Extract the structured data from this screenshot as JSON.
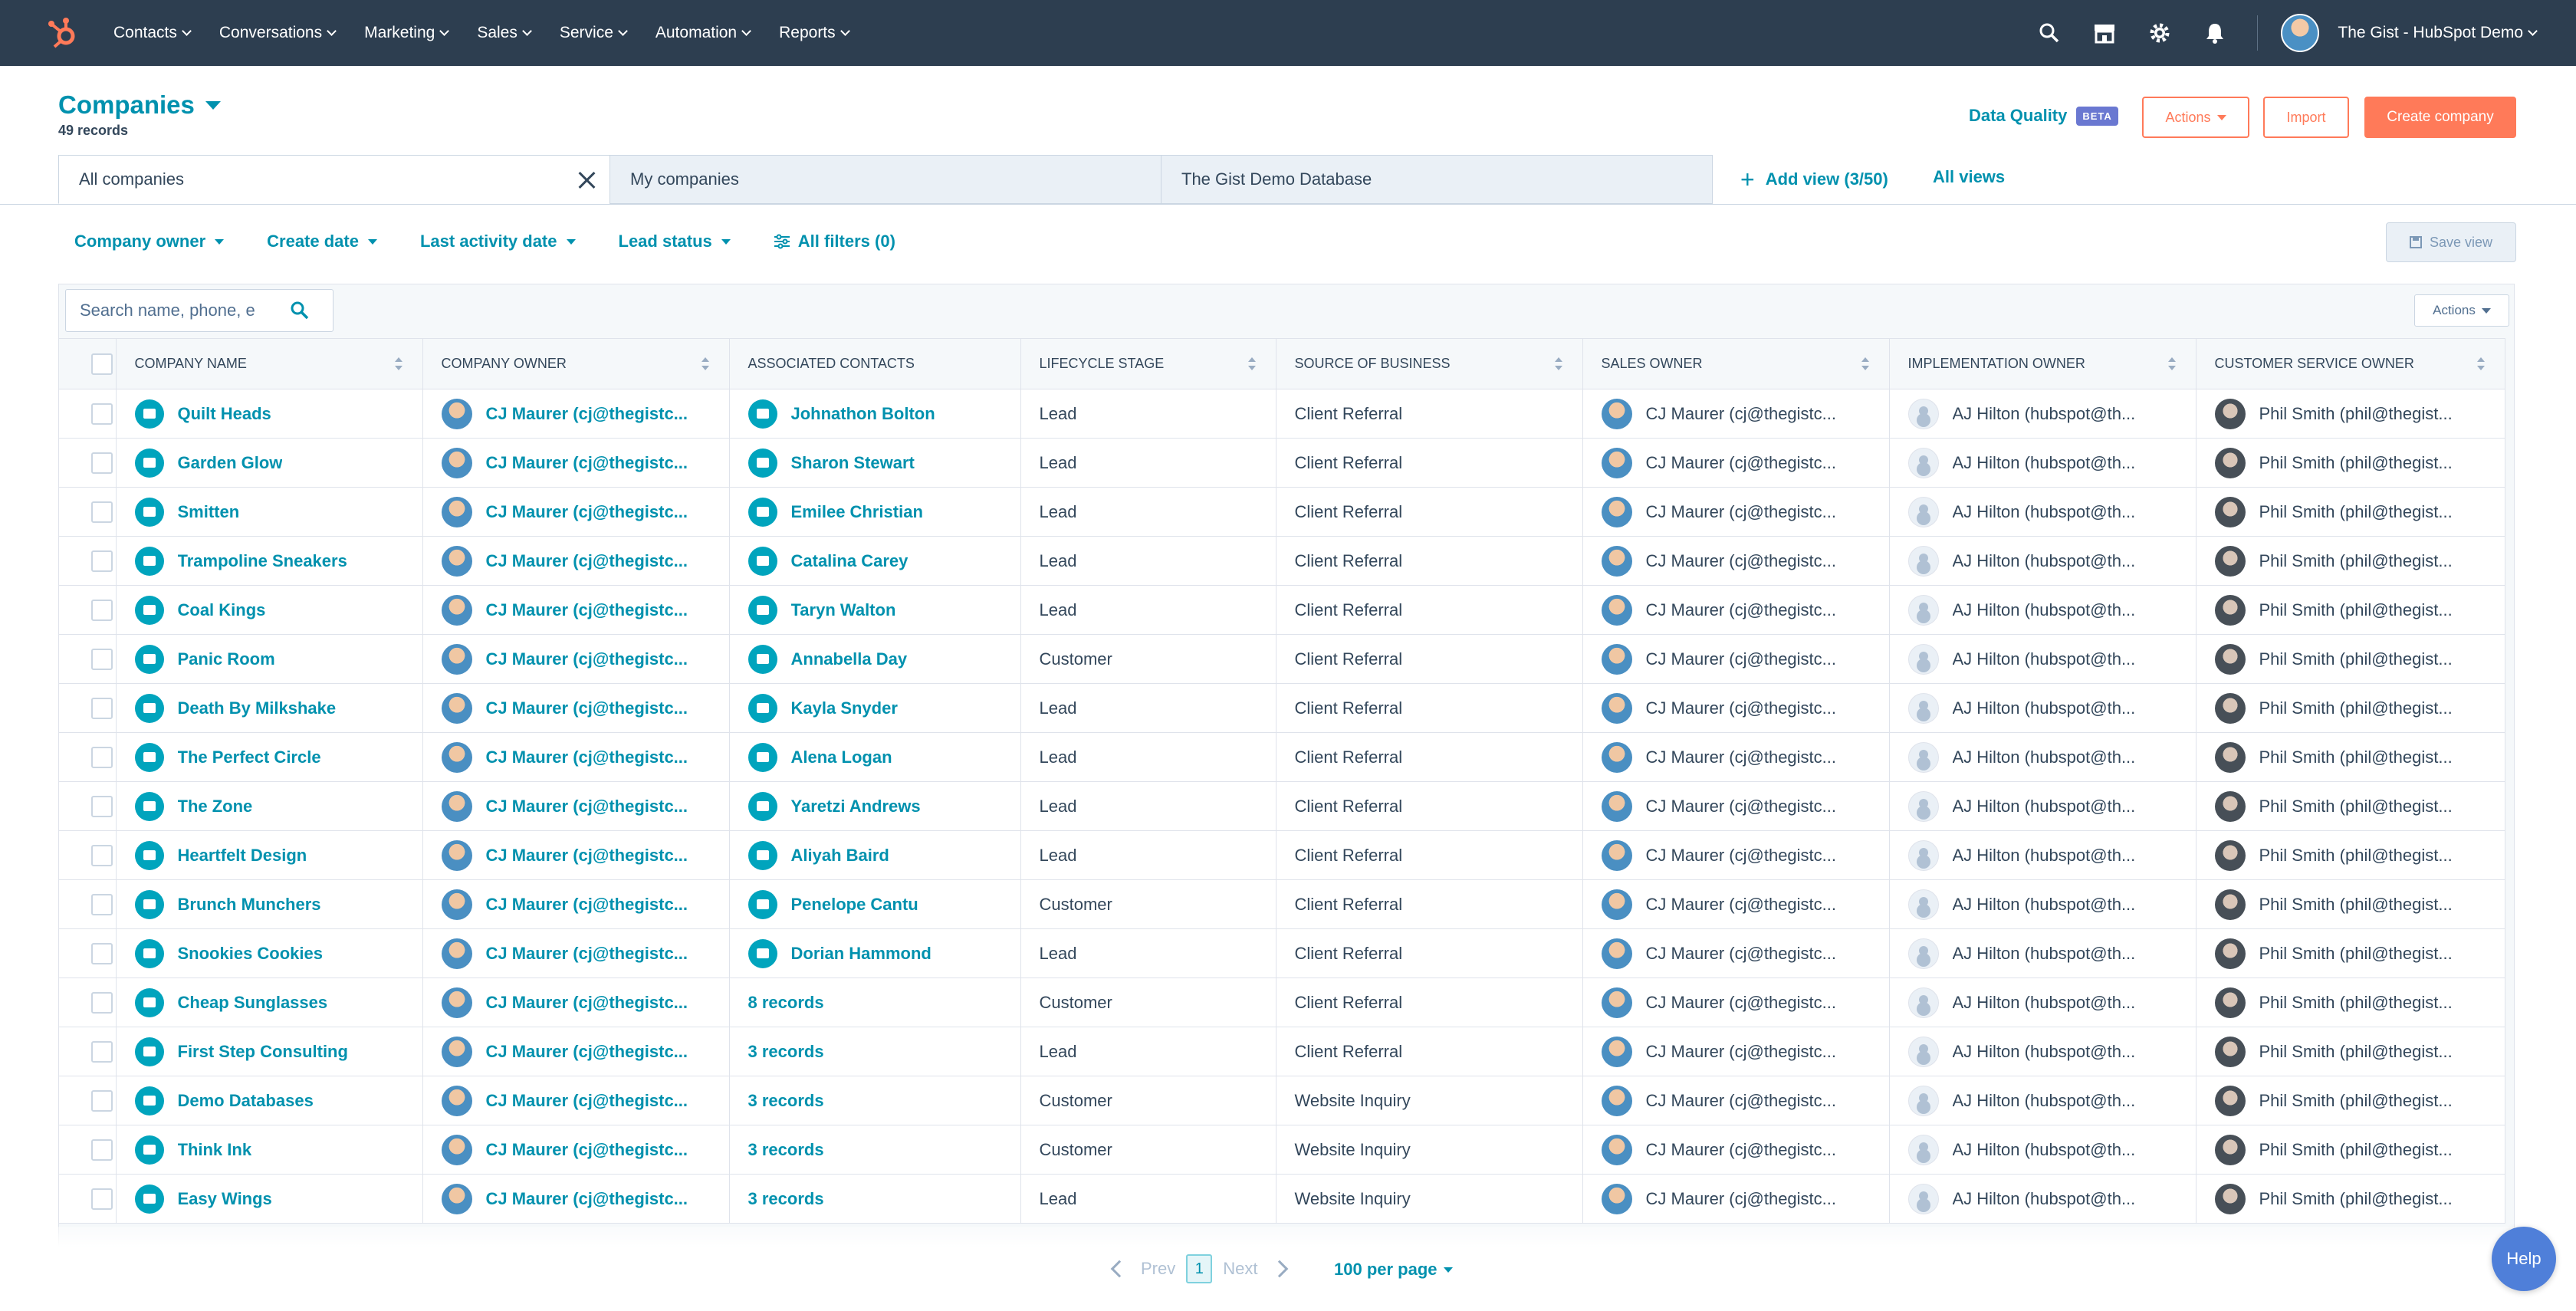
{
  "nav": {
    "items": [
      "Contacts",
      "Conversations",
      "Marketing",
      "Sales",
      "Service",
      "Automation",
      "Reports"
    ],
    "account": "The Gist - HubSpot Demo"
  },
  "header": {
    "title": "Companies",
    "record_count": "49 records",
    "data_quality": "Data Quality",
    "beta": "BETA",
    "actions": "Actions",
    "import": "Import",
    "create": "Create company"
  },
  "tabs": {
    "items": [
      "All companies",
      "My companies",
      "The Gist Demo Database"
    ],
    "add_view": "Add view (3/50)",
    "all_views": "All views"
  },
  "filters": {
    "items": [
      "Company owner",
      "Create date",
      "Last activity date",
      "Lead status"
    ],
    "all_filters": "All filters (0)",
    "save_view": "Save view"
  },
  "table": {
    "search_placeholder": "Search name, phone, e",
    "actions": "Actions",
    "columns": [
      "COMPANY NAME",
      "COMPANY OWNER",
      "ASSOCIATED CONTACTS",
      "LIFECYCLE STAGE",
      "SOURCE OF BUSINESS",
      "SALES OWNER",
      "IMPLEMENTATION OWNER",
      "CUSTOMER SERVICE OWNER"
    ],
    "rows": [
      {
        "name": "Quilt Heads",
        "owner": "CJ Maurer (cj@thegistc...",
        "contact": "Johnathon Bolton",
        "stage": "Lead",
        "source": "Client Referral",
        "sales": "CJ Maurer (cj@thegistc...",
        "impl": "AJ Hilton (hubspot@th...",
        "cs": "Phil Smith (phil@thegist..."
      },
      {
        "name": "Garden Glow",
        "owner": "CJ Maurer (cj@thegistc...",
        "contact": "Sharon Stewart",
        "stage": "Lead",
        "source": "Client Referral",
        "sales": "CJ Maurer (cj@thegistc...",
        "impl": "AJ Hilton (hubspot@th...",
        "cs": "Phil Smith (phil@thegist..."
      },
      {
        "name": "Smitten",
        "owner": "CJ Maurer (cj@thegistc...",
        "contact": "Emilee Christian",
        "stage": "Lead",
        "source": "Client Referral",
        "sales": "CJ Maurer (cj@thegistc...",
        "impl": "AJ Hilton (hubspot@th...",
        "cs": "Phil Smith (phil@thegist..."
      },
      {
        "name": "Trampoline Sneakers",
        "owner": "CJ Maurer (cj@thegistc...",
        "contact": "Catalina Carey",
        "stage": "Lead",
        "source": "Client Referral",
        "sales": "CJ Maurer (cj@thegistc...",
        "impl": "AJ Hilton (hubspot@th...",
        "cs": "Phil Smith (phil@thegist..."
      },
      {
        "name": "Coal Kings",
        "owner": "CJ Maurer (cj@thegistc...",
        "contact": "Taryn Walton",
        "stage": "Lead",
        "source": "Client Referral",
        "sales": "CJ Maurer (cj@thegistc...",
        "impl": "AJ Hilton (hubspot@th...",
        "cs": "Phil Smith (phil@thegist..."
      },
      {
        "name": "Panic Room",
        "owner": "CJ Maurer (cj@thegistc...",
        "contact": "Annabella Day",
        "stage": "Customer",
        "source": "Client Referral",
        "sales": "CJ Maurer (cj@thegistc...",
        "impl": "AJ Hilton (hubspot@th...",
        "cs": "Phil Smith (phil@thegist..."
      },
      {
        "name": "Death By Milkshake",
        "owner": "CJ Maurer (cj@thegistc...",
        "contact": "Kayla Snyder",
        "stage": "Lead",
        "source": "Client Referral",
        "sales": "CJ Maurer (cj@thegistc...",
        "impl": "AJ Hilton (hubspot@th...",
        "cs": "Phil Smith (phil@thegist..."
      },
      {
        "name": "The Perfect Circle",
        "owner": "CJ Maurer (cj@thegistc...",
        "contact": "Alena Logan",
        "stage": "Lead",
        "source": "Client Referral",
        "sales": "CJ Maurer (cj@thegistc...",
        "impl": "AJ Hilton (hubspot@th...",
        "cs": "Phil Smith (phil@thegist..."
      },
      {
        "name": "The Zone",
        "owner": "CJ Maurer (cj@thegistc...",
        "contact": "Yaretzi Andrews",
        "stage": "Lead",
        "source": "Client Referral",
        "sales": "CJ Maurer (cj@thegistc...",
        "impl": "AJ Hilton (hubspot@th...",
        "cs": "Phil Smith (phil@thegist..."
      },
      {
        "name": "Heartfelt Design",
        "owner": "CJ Maurer (cj@thegistc...",
        "contact": "Aliyah Baird",
        "stage": "Lead",
        "source": "Client Referral",
        "sales": "CJ Maurer (cj@thegistc...",
        "impl": "AJ Hilton (hubspot@th...",
        "cs": "Phil Smith (phil@thegist..."
      },
      {
        "name": "Brunch Munchers",
        "owner": "CJ Maurer (cj@thegistc...",
        "contact": "Penelope Cantu",
        "stage": "Customer",
        "source": "Client Referral",
        "sales": "CJ Maurer (cj@thegistc...",
        "impl": "AJ Hilton (hubspot@th...",
        "cs": "Phil Smith (phil@thegist..."
      },
      {
        "name": "Snookies Cookies",
        "owner": "CJ Maurer (cj@thegistc...",
        "contact": "Dorian Hammond",
        "stage": "Lead",
        "source": "Client Referral",
        "sales": "CJ Maurer (cj@thegistc...",
        "impl": "AJ Hilton (hubspot@th...",
        "cs": "Phil Smith (phil@thegist..."
      },
      {
        "name": "Cheap Sunglasses",
        "owner": "CJ Maurer (cj@thegistc...",
        "contact": "8 records",
        "stage": "Customer",
        "source": "Client Referral",
        "sales": "CJ Maurer (cj@thegistc...",
        "impl": "AJ Hilton (hubspot@th...",
        "cs": "Phil Smith (phil@thegist..."
      },
      {
        "name": "First Step Consulting",
        "owner": "CJ Maurer (cj@thegistc...",
        "contact": "3 records",
        "stage": "Lead",
        "source": "Client Referral",
        "sales": "CJ Maurer (cj@thegistc...",
        "impl": "AJ Hilton (hubspot@th...",
        "cs": "Phil Smith (phil@thegist..."
      },
      {
        "name": "Demo Databases",
        "owner": "CJ Maurer (cj@thegistc...",
        "contact": "3 records",
        "stage": "Customer",
        "source": "Website Inquiry",
        "sales": "CJ Maurer (cj@thegistc...",
        "impl": "AJ Hilton (hubspot@th...",
        "cs": "Phil Smith (phil@thegist..."
      },
      {
        "name": "Think Ink",
        "owner": "CJ Maurer (cj@thegistc...",
        "contact": "3 records",
        "stage": "Customer",
        "source": "Website Inquiry",
        "sales": "CJ Maurer (cj@thegistc...",
        "impl": "AJ Hilton (hubspot@th...",
        "cs": "Phil Smith (phil@thegist..."
      },
      {
        "name": "Easy Wings",
        "owner": "CJ Maurer (cj@thegistc...",
        "contact": "3 records",
        "stage": "Lead",
        "source": "Website Inquiry",
        "sales": "CJ Maurer (cj@thegistc...",
        "impl": "AJ Hilton (hubspot@th...",
        "cs": "Phil Smith (phil@thegist..."
      }
    ]
  },
  "pagination": {
    "prev": "Prev",
    "page": "1",
    "next": "Next",
    "per_page": "100 per page"
  },
  "help": "Help",
  "colors": {
    "nav_bg": "#2d3e50",
    "accent": "#0091ae",
    "brand": "#ff7a59",
    "company_icon": "#00a4bd"
  }
}
